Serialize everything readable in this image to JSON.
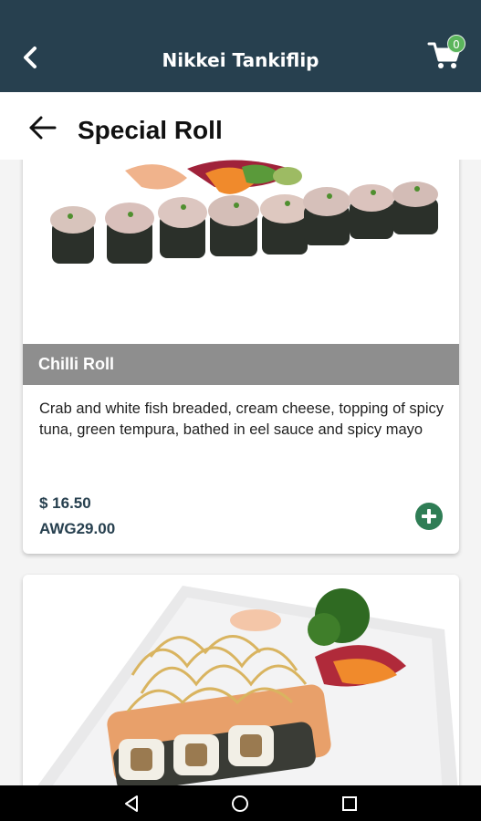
{
  "app": {
    "title": "Nikkei Tankiflip",
    "cart_count": "0"
  },
  "page": {
    "title": "Special Roll"
  },
  "items": [
    {
      "name": "Chilli Roll",
      "description": "Crab and white fish breaded, cream cheese, topping of spicy tuna, green tempura, bathed in eel sauce and spicy mayo",
      "price_usd": "$ 16.50",
      "price_awg": "AWG29.00"
    }
  ],
  "icons": {
    "back": "chevron-left-icon",
    "cart": "shopping-cart-icon",
    "page_back": "arrow-left-icon",
    "add": "plus-circle-icon",
    "nav_back": "triangle-back-icon",
    "nav_home": "circle-home-icon",
    "nav_recent": "square-recent-icon"
  },
  "colors": {
    "appbar": "#27404f",
    "badge": "#5bb55c",
    "add_button": "#2f7d55",
    "name_bar": "#8e8e8e",
    "price": "#27404f"
  }
}
